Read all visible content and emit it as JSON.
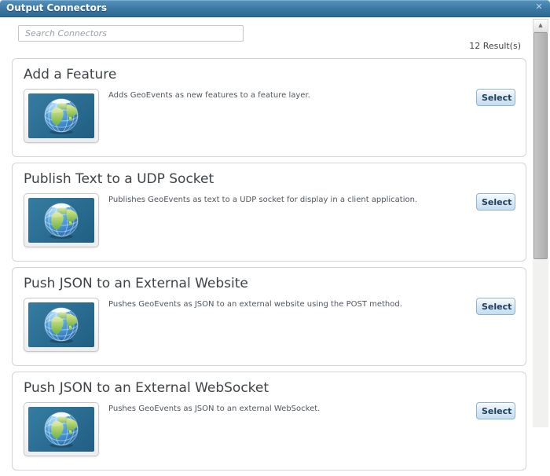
{
  "dialog": {
    "title": "Output Connectors"
  },
  "icons": {
    "close": "✕",
    "scroll_up": "▲",
    "globe": "globe-thumbnail"
  },
  "search": {
    "placeholder": "Search Connectors",
    "value": ""
  },
  "results": {
    "count_label": "12 Result(s)"
  },
  "labels": {
    "select": "Select"
  },
  "connectors": [
    {
      "title": "Add a Feature",
      "description": "Adds GeoEvents as new features to a feature layer."
    },
    {
      "title": "Publish Text to a UDP Socket",
      "description": "Publishes GeoEvents as text to a UDP socket for display in a client application."
    },
    {
      "title": "Push JSON to an External Website",
      "description": "Pushes GeoEvents as JSON to an external website using the POST method."
    },
    {
      "title": "Push JSON to an External WebSocket",
      "description": "Pushes GeoEvents as JSON to an external WebSocket."
    }
  ],
  "colors": {
    "titlebar_top": "#5693bd",
    "titlebar_bottom": "#2e6a94",
    "card_border": "#d4d4d4",
    "select_border": "#8fb2cd",
    "select_text": "#213f59",
    "thumb_bg_top": "#357ca1",
    "thumb_bg_bottom": "#215e83",
    "text_primary": "#3e4347",
    "text_secondary": "#4f565c"
  }
}
